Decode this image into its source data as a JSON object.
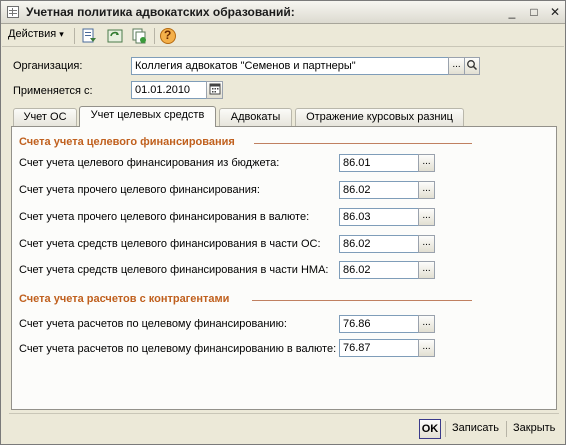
{
  "window": {
    "title": "Учетная политика адвокатских образований:",
    "minimize": "_",
    "maximize": "□",
    "close": "✕"
  },
  "toolbar": {
    "actions_label": "Действия",
    "actions_arrow": "▾",
    "help_glyph": "?"
  },
  "form": {
    "org_label": "Организация:",
    "org_value": "Коллегия адвокатов \"Семенов и партнеры\"",
    "org_select_glyph": "...",
    "org_search_glyph": "⌕",
    "date_label": "Применяется с:",
    "date_value": "01.01.2010"
  },
  "tabs": [
    {
      "label": "Учет ОС"
    },
    {
      "label": "Учет целевых средств"
    },
    {
      "label": "Адвокаты"
    },
    {
      "label": "Отражение курсовых разниц"
    }
  ],
  "sections": {
    "financing": {
      "title": "Счета учета целевого финансирования",
      "rows": [
        {
          "label": "Счет учета целевого финансирования из бюджета:",
          "value": "86.01"
        },
        {
          "label": "Счет учета прочего целевого финансирования:",
          "value": "86.02"
        },
        {
          "label": "Счет учета прочего целевого финансирования в валюте:",
          "value": "86.03"
        },
        {
          "label": "Счет учета средств целевого финансирования в части ОС:",
          "value": "86.02"
        },
        {
          "label": "Счет учета средств целевого финансирования в части НМА:",
          "value": "86.02"
        }
      ]
    },
    "counterparties": {
      "title": "Счета учета расчетов с контрагентами",
      "rows": [
        {
          "label": "Счет учета расчетов по целевому финансированию:",
          "value": "76.86"
        },
        {
          "label": "Счет учета расчетов по целевому финансированию в валюте:",
          "value": "76.87"
        }
      ]
    }
  },
  "select_glyph": "...",
  "footer": {
    "ok": "OK",
    "save": "Записать",
    "close": "Закрыть"
  },
  "colors": {
    "section_title": "#c0601e",
    "window_bg": "#ece9d8",
    "panel_bg": "#fcfcfa"
  }
}
